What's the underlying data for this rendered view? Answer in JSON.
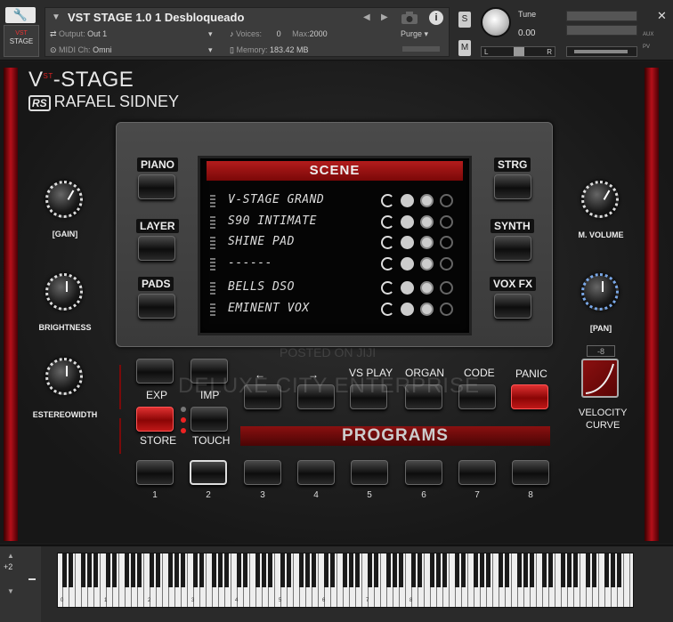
{
  "host": {
    "instrument_name": "VST STAGE 1.0 1 Desbloqueado",
    "output_label": "Output:",
    "output_value": "Out 1",
    "midi_label": "MIDI Ch:",
    "midi_value": "Omni",
    "voices_label": "Voices:",
    "voices_value": "0",
    "max_label": "Max:",
    "max_value": "2000",
    "memory_label": "Memory:",
    "memory_value": "183.42 MB",
    "purge_label": "Purge",
    "solo": "S",
    "mute": "M",
    "tune_label": "Tune",
    "tune_value": "0.00",
    "pan_left": "L",
    "pan_right": "R",
    "aux": "AUX",
    "pv": "PV",
    "thumb_top": "VST",
    "thumb_bottom": "STAGE"
  },
  "logo": {
    "line1_pre": "V",
    "line1_sup": "ST",
    "line1_post": "-STAGE",
    "line2_badge": "RS",
    "line2_text": "RAFAEL SIDNEY"
  },
  "scene": {
    "title": "SCENE",
    "rows": [
      "V-STAGE GRAND",
      "S90 INTIMATE",
      "SHINE PAD",
      "------",
      "BELLS DSO",
      "EMINENT VOX"
    ]
  },
  "left_buttons": [
    "PIANO",
    "LAYER",
    "PADS"
  ],
  "right_buttons": [
    "STRG",
    "SYNTH",
    "VOX FX"
  ],
  "knobs": {
    "gain": "[GAIN]",
    "brightness": "BRIGHTNESS",
    "stereo": "ESTEREOWIDTH",
    "volume": "M. VOLUME",
    "pan": "[PAN]"
  },
  "controls": {
    "exp": "EXP",
    "imp": "IMP",
    "store": "STORE",
    "touch": "TOUCH",
    "arrow_left": "←",
    "arrow_right": "→",
    "vs_play": "VS PLAY",
    "organ": "ORGAN",
    "code": "CODE",
    "panic": "PANIC",
    "programs": "PROGRAMS",
    "program_numbers": [
      "1",
      "2",
      "3",
      "4",
      "5",
      "6",
      "7",
      "8"
    ],
    "velocity_value": "-8",
    "velocity_label_1": "VELOCITY",
    "velocity_label_2": "CURVE"
  },
  "watermark": {
    "line1": "POSTED ON JIJI",
    "line2": "DELUXE CITY ENTERPRISE"
  },
  "keyboard": {
    "octave_shift": "+2",
    "octave_marks": [
      "0",
      "1",
      "2",
      "3",
      "4",
      "5",
      "6",
      "7",
      "8"
    ]
  },
  "colors": {
    "accent_red": "#b5101a",
    "panel": "#3a3a3a",
    "background": "#1a1a1a"
  }
}
